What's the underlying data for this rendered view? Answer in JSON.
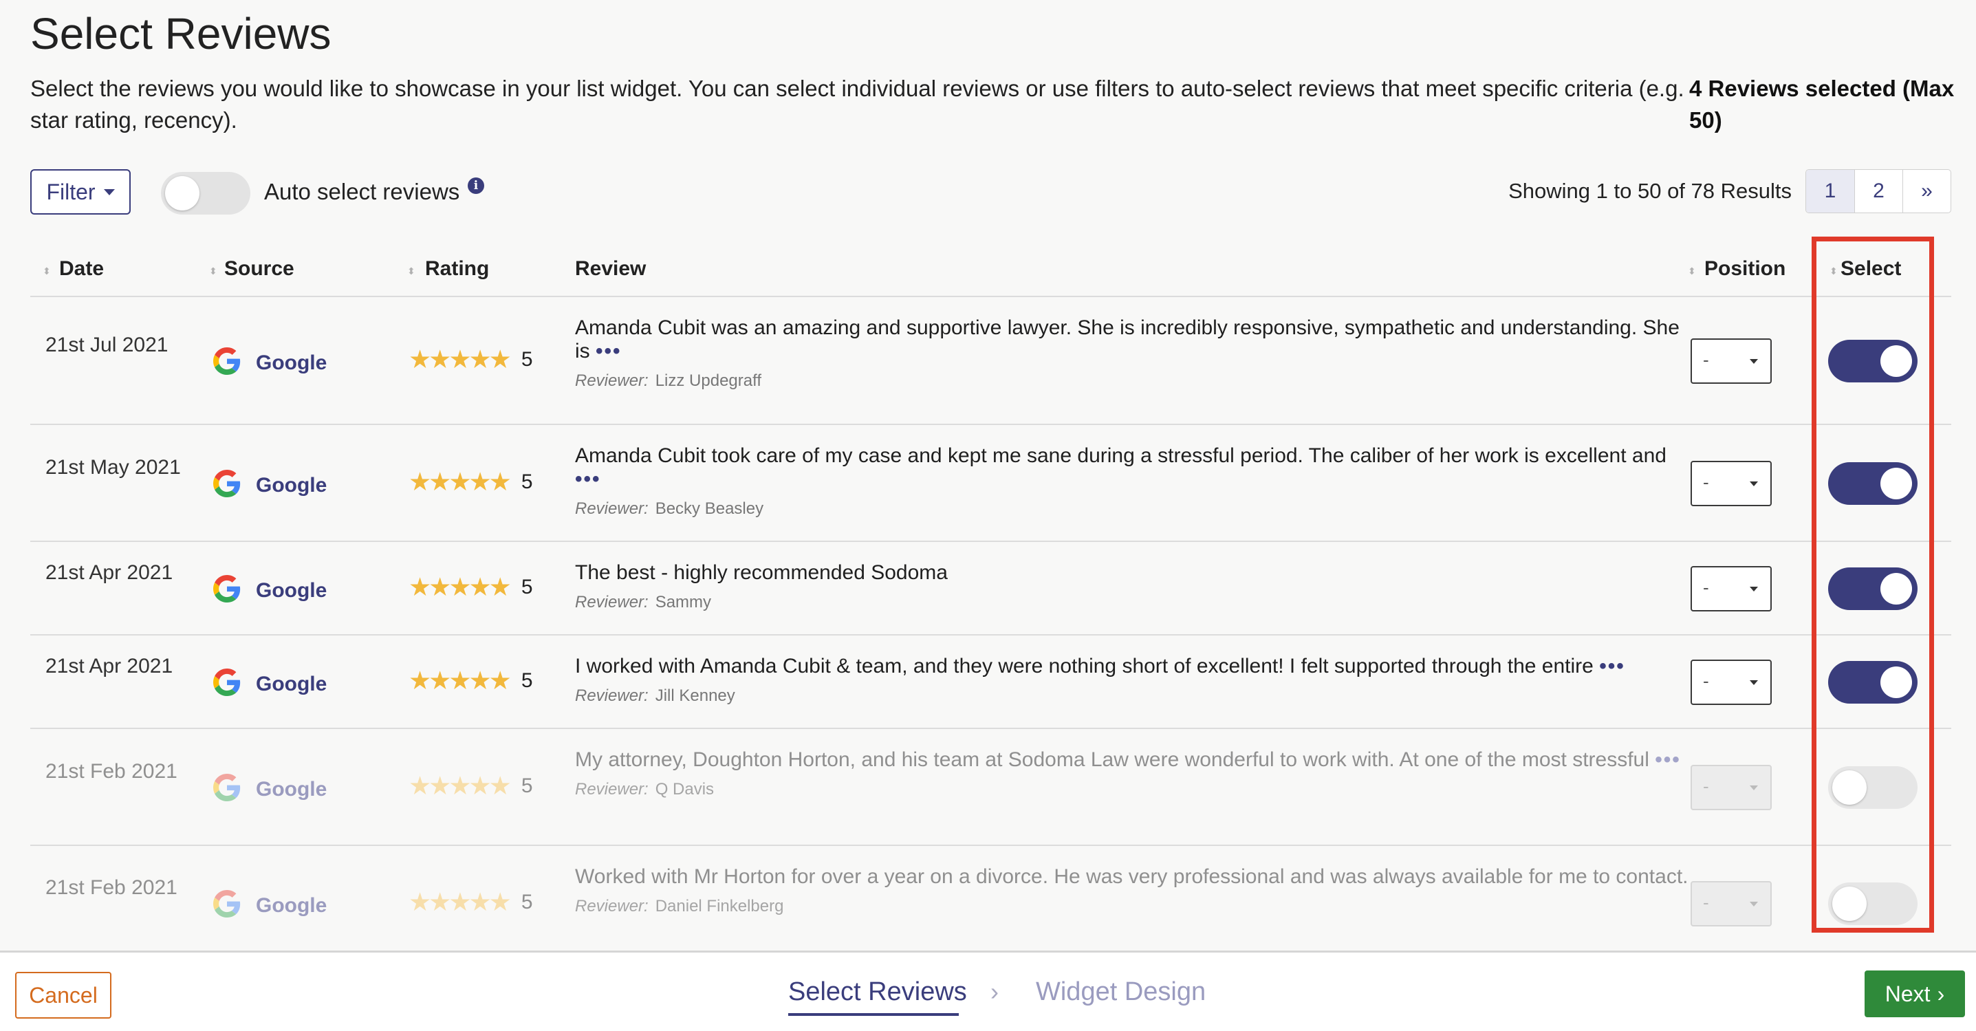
{
  "page": {
    "title": "Select Reviews",
    "intro": "Select the reviews you would like to showcase in your list widget. You can select individual reviews or use filters to auto-select reviews that meet specific criteria (e.g. star rating, recency).",
    "selected_count": "4 Reviews selected (Max 50)"
  },
  "toolbar": {
    "filter_label": "Filter",
    "auto_select_label": "Auto select reviews",
    "auto_select_on": false,
    "info_glyph": "i",
    "results_text": "Showing 1 to 50 of 78 Results",
    "pages": [
      "1",
      "2",
      "»"
    ]
  },
  "table": {
    "headers": {
      "date": "Date",
      "source": "Source",
      "rating": "Rating",
      "review": "Review",
      "position": "Position",
      "select": "Select"
    },
    "reviewer_label": "Reviewer:",
    "more_glyph": "•••",
    "rows": [
      {
        "date": "21st Jul 2021",
        "source": "Google",
        "stars": "★★★★★",
        "rating": "5",
        "review": "Amanda Cubit was an amazing and supportive lawyer. She is incredibly responsive, sympathetic and understanding. She is",
        "reviewer": "Lizz Updegraff",
        "position": "-",
        "selected": true
      },
      {
        "date": "21st May 2021",
        "source": "Google",
        "stars": "★★★★★",
        "rating": "5",
        "review": "Amanda Cubit took care of my case and kept me sane during a stressful period. The caliber of her work is excellent and",
        "reviewer": "Becky Beasley",
        "position": "-",
        "selected": true
      },
      {
        "date": "21st Apr 2021",
        "source": "Google",
        "stars": "★★★★★",
        "rating": "5",
        "review": "The best - highly recommended Sodoma",
        "reviewer": "Sammy",
        "position": "-",
        "selected": true
      },
      {
        "date": "21st Apr 2021",
        "source": "Google",
        "stars": "★★★★★",
        "rating": "5",
        "review": "I worked with Amanda Cubit & team, and they were nothing short of excellent! I felt supported through the entire",
        "reviewer": "Jill Kenney",
        "position": "-",
        "selected": true
      },
      {
        "date": "21st Feb 2021",
        "source": "Google",
        "stars": "★★★★★",
        "rating": "5",
        "review": "My attorney, Doughton Horton, and his team at Sodoma Law were wonderful to work with. At one of the most stressful",
        "reviewer": "Q Davis",
        "position": "-",
        "selected": false
      },
      {
        "date": "21st Feb 2021",
        "source": "Google",
        "stars": "★★★★★",
        "rating": "5",
        "review": "Worked with Mr Horton for over a year on a divorce. He was very professional and was always available for me to contact.",
        "reviewer": "Daniel Finkelberg",
        "position": "-",
        "selected": false
      }
    ]
  },
  "footer": {
    "cancel_label": "Cancel",
    "step_current": "Select Reviews",
    "step_arrow": "›",
    "step_next": "Widget Design",
    "next_label": "Next",
    "next_glyph": "›"
  },
  "colors": {
    "accent": "#3a3d7c",
    "next_button": "#2f8a3a",
    "cancel": "#d46b1e",
    "highlight": "#e03a2a",
    "star": "#f2b83c"
  },
  "icons": {
    "source_logo": "google-g-icon",
    "filter_caret": "caret-down-icon",
    "info": "info-icon",
    "next": "chevron-right-icon",
    "sort": "sort-icon"
  }
}
